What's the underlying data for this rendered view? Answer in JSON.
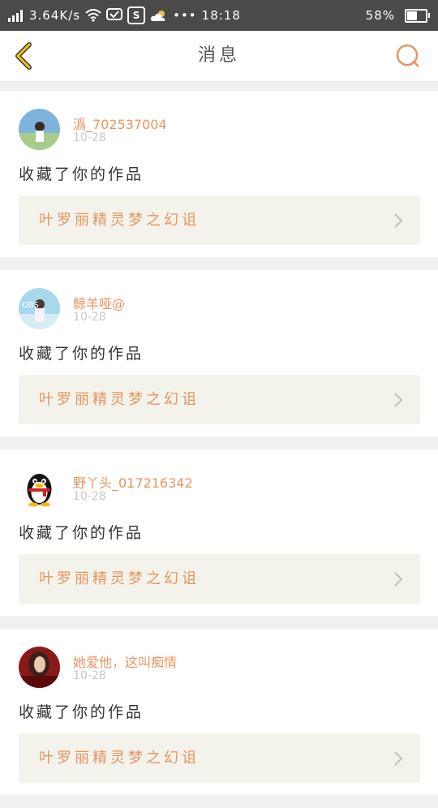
{
  "status_bar": {
    "speed": "3.64K/s",
    "time": "18:18",
    "battery": "58%",
    "battery_level": 0.58,
    "icons": [
      "signal-icon",
      "wifi-icon",
      "message-icon",
      "s-app-icon",
      "weather-cloud-icon",
      "more-dots-icon",
      "battery-icon"
    ],
    "s_badge": "S",
    "dots": "•••"
  },
  "nav": {
    "title": "消息",
    "accent_color": "#f5c518",
    "search_color": "#e8945e"
  },
  "colors": {
    "name": "#e8945e",
    "date": "#c8c8c8",
    "work_bg": "#f3f3ec",
    "statusbar_bg": "#4a4a4a"
  },
  "messages": [
    {
      "avatar": "girl-photo-avatar",
      "username": "潙_702537004",
      "date": "10-28",
      "action": "收藏了你的作品",
      "work_title": "叶罗丽精灵梦之幻诅"
    },
    {
      "avatar": "girl-photo-avatar",
      "username": "鲸羊哑@",
      "date": "10-28",
      "action": "收藏了你的作品",
      "work_title": "叶罗丽精灵梦之幻诅"
    },
    {
      "avatar": "qq-penguin-avatar",
      "username": "野丫头_017216342",
      "date": "10-28",
      "action": "收藏了你的作品",
      "work_title": "叶罗丽精灵梦之幻诅"
    },
    {
      "avatar": "girl-photo-avatar",
      "username": "她爱他，这叫痴情",
      "date": "10-28",
      "action": "收藏了你的作品",
      "work_title": "叶罗丽精灵梦之幻诅"
    }
  ]
}
